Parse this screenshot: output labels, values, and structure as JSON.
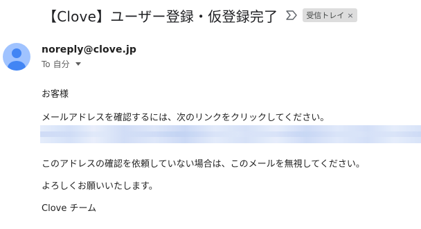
{
  "email": {
    "subject": "【Clove】ユーザー登録・仮登録完了",
    "label": "受信トレイ",
    "label_remove": "×",
    "sender_email": "noreply@clove.jp",
    "to_prefix": "To",
    "to_value": "自分",
    "greeting": "お客様",
    "instruction": "メールアドレスを確認するには、次のリンクをクリックしてください。",
    "disclaimer": "このアドレスの確認を依頼していない場合は、このメールを無視してください。",
    "closing": "よろしくお願いいたします。",
    "signature": "Clove チーム"
  },
  "icons": {
    "important_marker": "important-marker-icon",
    "avatar": "default-avatar-icon",
    "expand": "chevron-down-icon"
  },
  "colors": {
    "label_chip_bg": "#dddddd",
    "avatar_bg": "#a0c3ff",
    "avatar_figure": "#4285f4"
  }
}
